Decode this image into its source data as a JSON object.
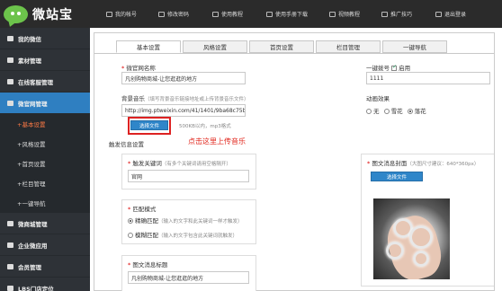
{
  "brand": {
    "name": "微站宝",
    "color": "#6cc34b"
  },
  "topnav": [
    {
      "label": "我的帐号",
      "icon": "user-icon"
    },
    {
      "label": "修改密码",
      "icon": "lock-icon"
    },
    {
      "label": "使用教程",
      "icon": "book-icon"
    },
    {
      "label": "使用手册下载",
      "icon": "download-icon"
    },
    {
      "label": "视频教程",
      "icon": "video-icon"
    },
    {
      "label": "推广技巧",
      "icon": "star-icon"
    },
    {
      "label": "退出登录",
      "icon": "logout-icon"
    }
  ],
  "sidebar": {
    "items": [
      {
        "label": "我的微信",
        "icon": "wechat-icon"
      },
      {
        "label": "素材管理",
        "icon": "pen-icon"
      },
      {
        "label": "在线客服管理",
        "icon": "people-icon"
      },
      {
        "label": "微官网管理",
        "icon": "home-icon"
      }
    ],
    "subitems": [
      {
        "label": "+基本设置"
      },
      {
        "label": "+风格设置"
      },
      {
        "label": "+首页设置"
      },
      {
        "label": "+栏目管理"
      },
      {
        "label": "+一键导航"
      }
    ],
    "bottom_items": [
      {
        "label": "微商城管理",
        "icon": "cart-icon"
      },
      {
        "label": "企业微应用",
        "icon": "app-icon"
      },
      {
        "label": "会员管理",
        "icon": "card-icon"
      },
      {
        "label": "LBS门店定位",
        "icon": "pin-icon"
      }
    ],
    "active_color": "#2f7fc1"
  },
  "tabs": [
    {
      "label": "基本设置"
    },
    {
      "label": "风格设置"
    },
    {
      "label": "首页设置"
    },
    {
      "label": "栏目管理"
    },
    {
      "label": "一键导航"
    }
  ],
  "form": {
    "site_name": {
      "label": "微官网名称",
      "value": "凡创购物商城-让您逛逛的地方"
    },
    "bg_music": {
      "label": "背景音乐",
      "hint": "（填写背景音乐链接地址或上传背景音乐文件）",
      "value": "http://img.ptweixin.com/41/1401/9ba68c75bf.mp3",
      "button": "选择文件",
      "limit": "500KB以内，mp3格式"
    },
    "annotation": "点击这里上传音乐",
    "phone": {
      "label": "一键拨号",
      "checkbox_label": "启用",
      "value": "1111"
    },
    "animation": {
      "label": "动画效果",
      "options": [
        "无",
        "雪花",
        "落花"
      ],
      "selected": "落花"
    },
    "trigger_section": "触发信息设置",
    "keyword": {
      "label": "触发关键词",
      "hint": "（有多个关键词请用空格隔开）",
      "value": "官网"
    },
    "cover": {
      "label": "图文消息封面",
      "hint": "（大图尺寸建议：640*360px）",
      "button": "选择文件"
    },
    "match": {
      "label": "匹配模式",
      "options": [
        {
          "name": "精确匹配",
          "hint": "（输入的文字和此关键词一样才触发）"
        },
        {
          "name": "模糊匹配",
          "hint": "（输入的文字包含此关键词就触发）"
        }
      ]
    },
    "msg_title": {
      "label": "图文消息标题",
      "value": "凡创购物商城-让您逛逛的地方"
    }
  },
  "colors": {
    "accent": "#2f86c9",
    "annotation": "#e1251b"
  }
}
